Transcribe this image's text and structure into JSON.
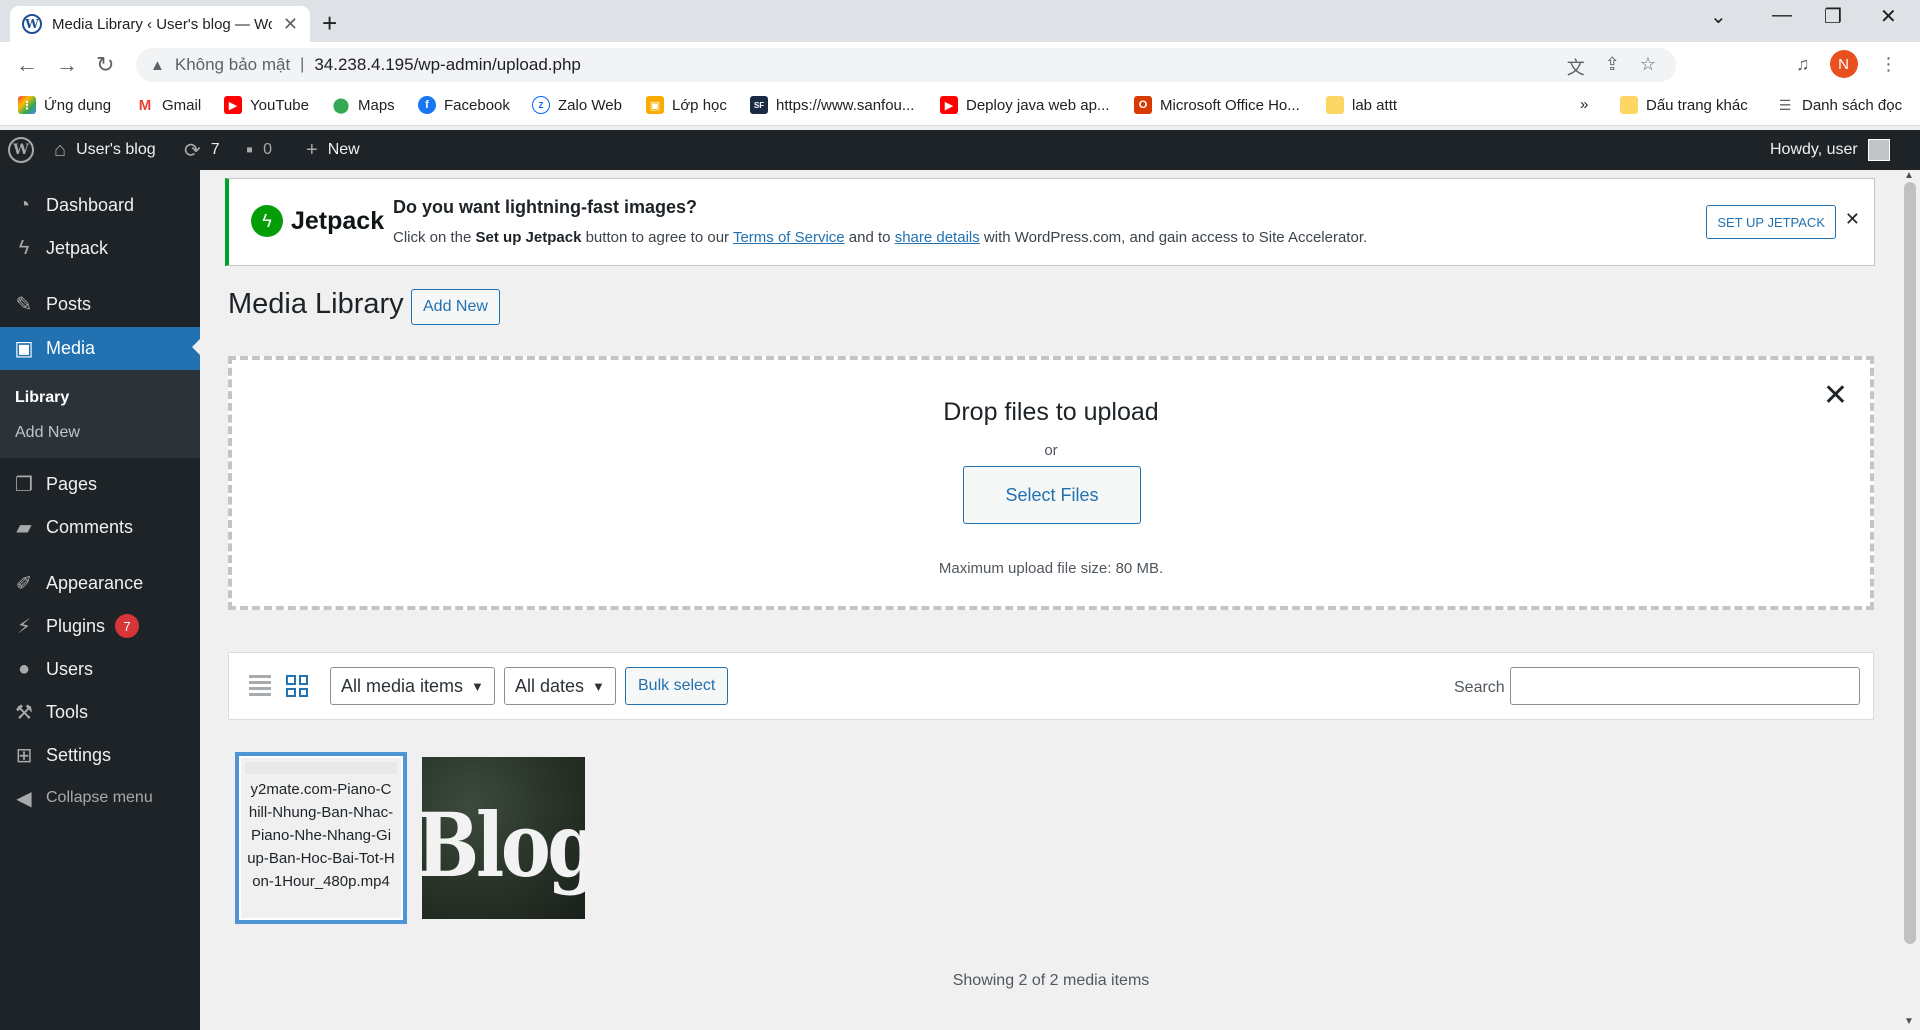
{
  "browser": {
    "tab_title": "Media Library ‹ User's blog — WordPress",
    "new_tab": "+",
    "address": {
      "security": "Không bảo mật",
      "separator": "|",
      "url": "34.238.4.195/wp-admin/upload.php"
    },
    "profile_initial": "N",
    "bookmarks": [
      {
        "label": "Ứng dụng",
        "icon": "apps-grid-icon"
      },
      {
        "label": "Gmail",
        "icon": "gmail-icon"
      },
      {
        "label": "YouTube",
        "icon": "youtube-icon"
      },
      {
        "label": "Maps",
        "icon": "maps-icon"
      },
      {
        "label": "Facebook",
        "icon": "facebook-icon"
      },
      {
        "label": "Zalo Web",
        "icon": "zalo-icon"
      },
      {
        "label": "Lớp học",
        "icon": "classroom-icon"
      },
      {
        "label": "https://www.sanfou...",
        "icon": "sanfoundry-icon"
      },
      {
        "label": "Deploy java web ap...",
        "icon": "youtube-icon"
      },
      {
        "label": "Microsoft Office Ho...",
        "icon": "office-icon"
      },
      {
        "label": "lab attt",
        "icon": "folder-icon"
      }
    ],
    "bookmarks_overflow": "»",
    "other_bookmarks": "Dấu trang khác",
    "reading_list": "Danh sách đọc"
  },
  "adminbar": {
    "site_name": "User's blog",
    "updates_count": "7",
    "comments_count": "0",
    "new_label": "New",
    "howdy": "Howdy, user"
  },
  "sidebar": {
    "items": [
      {
        "label": "Dashboard",
        "icon": "dashboard-icon"
      },
      {
        "label": "Jetpack",
        "icon": "jetpack-icon"
      },
      {
        "label": "Posts",
        "icon": "pin-icon"
      },
      {
        "label": "Media",
        "icon": "media-icon"
      },
      {
        "label": "Pages",
        "icon": "pages-icon"
      },
      {
        "label": "Comments",
        "icon": "comment-icon"
      },
      {
        "label": "Appearance",
        "icon": "brush-icon"
      },
      {
        "label": "Plugins",
        "icon": "plugin-icon"
      },
      {
        "label": "Users",
        "icon": "user-icon"
      },
      {
        "label": "Tools",
        "icon": "wrench-icon"
      },
      {
        "label": "Settings",
        "icon": "settings-icon"
      }
    ],
    "media_sub": {
      "library": "Library",
      "add_new": "Add New"
    },
    "plugins_badge": "7",
    "collapse": "Collapse menu"
  },
  "notice": {
    "brand": "Jetpack",
    "title": "Do you want lightning-fast images?",
    "text_1": "Click on the ",
    "text_bold": "Set up Jetpack",
    "text_2": " button to agree to our ",
    "link_tos": "Terms of Service",
    "text_3": " and to ",
    "link_share": "share details",
    "text_4": " with WordPress.com, and gain access to Site Accelerator.",
    "button": "SET UP JETPACK"
  },
  "page": {
    "title": "Media Library",
    "add_new": "Add New"
  },
  "dropzone": {
    "title": "Drop files to upload",
    "or": "or",
    "button": "Select Files",
    "max_size": "Maximum upload file size: 80 MB."
  },
  "toolbar": {
    "filter_type": "All media items",
    "filter_date": "All dates",
    "bulk_select": "Bulk select",
    "search_label": "Search",
    "search_value": ""
  },
  "media": {
    "items": [
      {
        "type": "video",
        "filename": "y2mate.com-Piano-Chill-Nhung-Ban-Nhac-Piano-Nhe-Nhang-Giup-Ban-Hoc-Bai-Tot-Hon-1Hour_480p.mp4"
      },
      {
        "type": "image",
        "caption_text": "Blog"
      }
    ],
    "showing": "Showing 2 of 2 media items"
  },
  "colors": {
    "wp_dark": "#1d2327",
    "wp_blue": "#2271b1",
    "jetpack_green": "#069e08",
    "badge_red": "#d63638"
  }
}
